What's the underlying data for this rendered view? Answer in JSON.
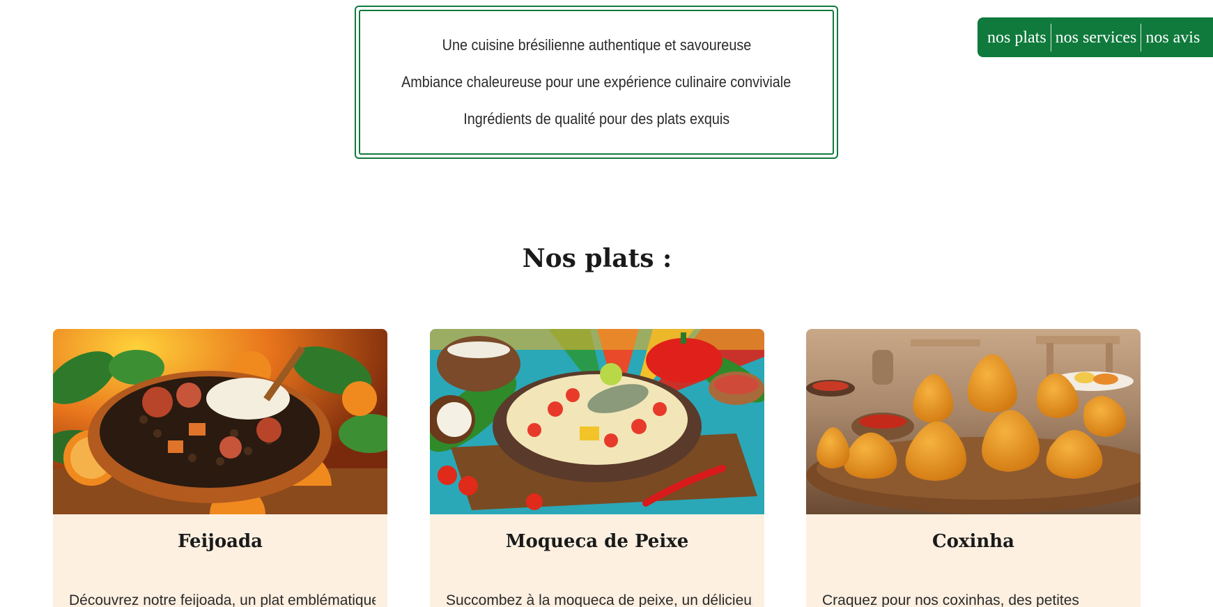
{
  "nav": {
    "items": [
      {
        "label": "nos plats"
      },
      {
        "label": "nos services"
      },
      {
        "label": "nos avis"
      }
    ],
    "color": "#0f7a3c"
  },
  "features": {
    "lines": [
      "Une cuisine brésilienne authentique et savoureuse",
      "Ambiance chaleureuse pour une expérience culinaire conviviale",
      "Ingrédients de qualité pour des plats exquis"
    ]
  },
  "section": {
    "title": "Nos plats :"
  },
  "dishes": [
    {
      "name": "Feijoada",
      "description": "Découvrez notre feijoada, un plat emblématique"
    },
    {
      "name": "Moqueca de Peixe",
      "description": "Succombez à la moqueca de peixe, un délicieux"
    },
    {
      "name": "Coxinha",
      "description": "Craquez pour nos coxinhas, des petites"
    }
  ],
  "colors": {
    "brand_green": "#0f7a3c",
    "card_background": "#fdf0e1"
  }
}
